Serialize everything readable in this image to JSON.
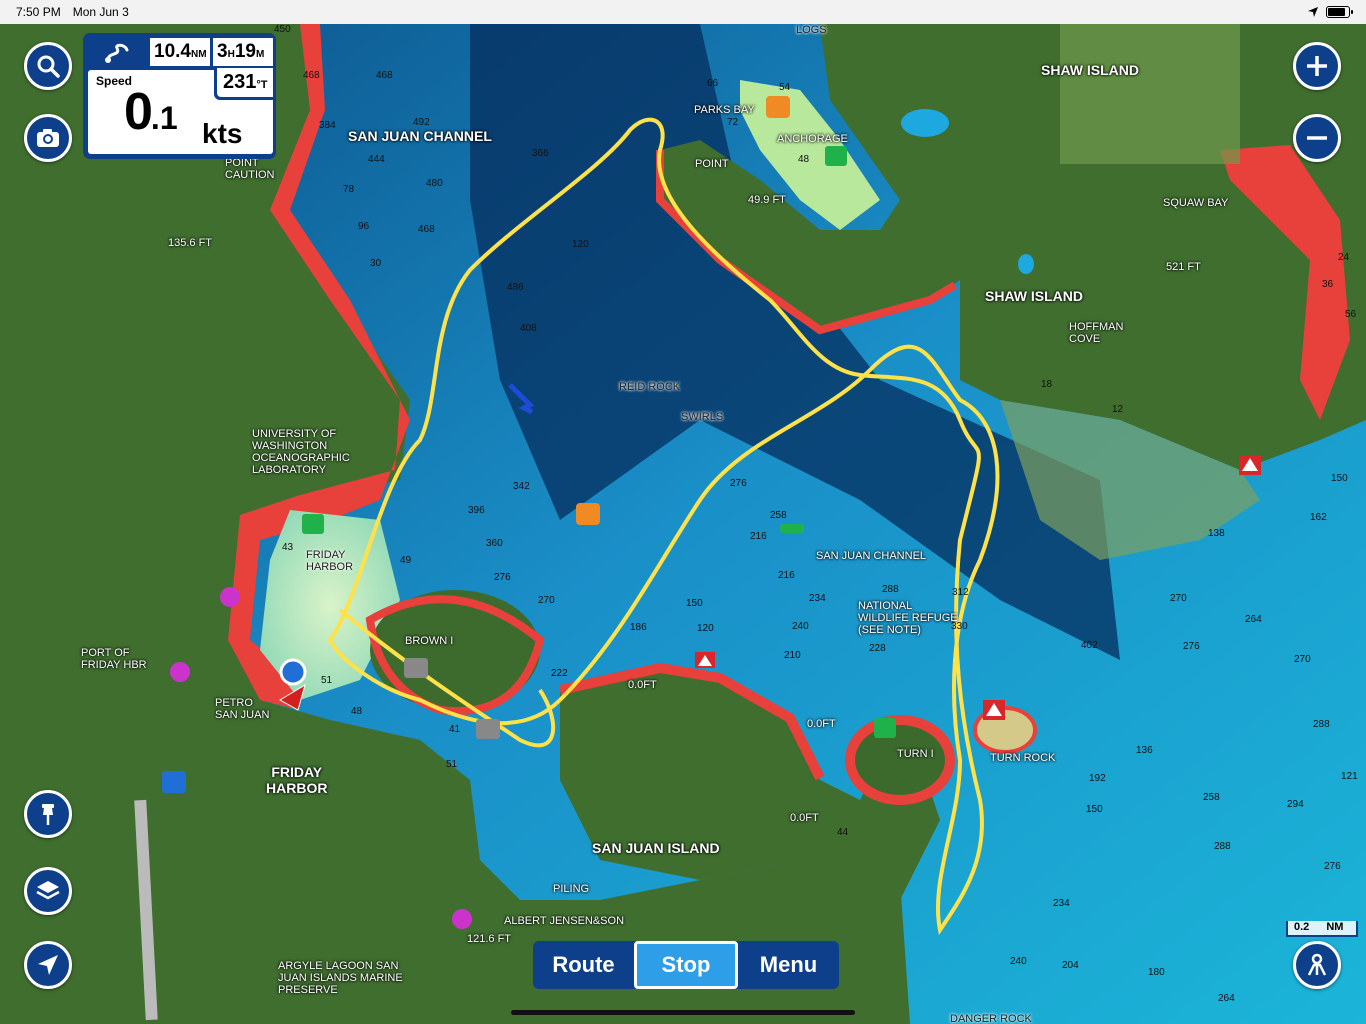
{
  "status_bar": {
    "time": "7:50 PM",
    "date": "Mon Jun 3"
  },
  "data_panel": {
    "distance": "10.4",
    "distance_unit": "NM",
    "eta_h": "3",
    "eta_m": "19",
    "speed_label": "Speed",
    "speed_int": "0",
    "speed_dec": ".1",
    "speed_unit": "kts",
    "heading": "231",
    "heading_unit": "°T"
  },
  "bottom_bar": {
    "route_label": "Route",
    "stop_label": "Stop",
    "menu_label": "Menu"
  },
  "scale": {
    "value": "0.2",
    "unit": "NM"
  },
  "map_labels": {
    "san_juan_channel_n": "SAN JUAN CHANNEL",
    "san_juan_channel_c": "SAN JUAN CHANNEL",
    "shaw_island_1": "SHAW ISLAND",
    "shaw_island_2": "SHAW ISLAND",
    "squaw_bay": "SQUAW BAY",
    "hoffman_cove": "HOFFMAN\nCOVE",
    "parks_bay": "PARKS BAY",
    "anchorage": "ANCHORAGE",
    "point_n": "POINT",
    "point_caution": "POINT\nCAUTION",
    "friday_harbor_town": "FRIDAY\nHARBOR",
    "friday_harbor_water": "FRIDAY\nHARBOR",
    "port_of_friday": "PORT OF\nFRIDAY HBR",
    "petro": "PETRO\nSAN JUAN",
    "university": "UNIVERSITY OF\nWASHINGTON\nOCEANOGRAPHIC\nLABORATORY",
    "brown_i": "BROWN I",
    "reid_rock": "REID ROCK",
    "swirls": "SWIRLS",
    "nwr": "NATIONAL\nWILDLIFE REFUGE\n(SEE NOTE)",
    "turn_i": "TURN I",
    "turn_rock": "TURN ROCK",
    "san_juan_island": "SAN JUAN ISLAND",
    "albert_jensen": "ALBERT JENSEN&SON",
    "piling": "PILING",
    "argyle": "ARGYLE LAGOON SAN\nJUAN ISLANDS MARINE\nPRESERVE",
    "danger_rock": "DANGER ROCK",
    "logs": "LOGS",
    "ft_1356": "135.6 FT",
    "ft_499": "49.9 FT",
    "ft_521": "521 FT",
    "ft_1216": "121.6 FT",
    "ft_0a": "0.0FT",
    "ft_0b": "0.0FT",
    "ft_0c": "0.0FT"
  },
  "depths": [
    "450",
    "468",
    "468",
    "492",
    "444",
    "480",
    "468",
    "384",
    "78",
    "96",
    "30",
    "486",
    "408",
    "366",
    "120",
    "396",
    "360",
    "276",
    "270",
    "342",
    "276",
    "258",
    "216",
    "216",
    "234",
    "240",
    "210",
    "186",
    "150",
    "120",
    "222",
    "288",
    "228",
    "330",
    "312",
    "402",
    "270",
    "264",
    "276",
    "270",
    "288",
    "294",
    "258",
    "288",
    "276",
    "234",
    "204",
    "180",
    "264",
    "240",
    "138",
    "150",
    "162",
    "192",
    "150",
    "121",
    "136",
    "56",
    "54",
    "48",
    "43",
    "49",
    "51",
    "48",
    "72",
    "66",
    "41",
    "51",
    "44",
    "24",
    "36",
    "18",
    "12"
  ],
  "colors": {
    "panel_blue": "#0d3f8a",
    "stop_active": "#2f9ee8",
    "track_yellow": "#ffe14a",
    "shallow_red": "#e8403a",
    "deep_water": "#1aa5d0"
  },
  "icons": {
    "search": "search-icon",
    "camera": "camera-icon",
    "zoom_in": "plus-icon",
    "zoom_out": "minus-icon",
    "pin": "pin-icon",
    "layers": "layers-icon",
    "locate": "location-arrow-icon",
    "person": "person-icon"
  }
}
